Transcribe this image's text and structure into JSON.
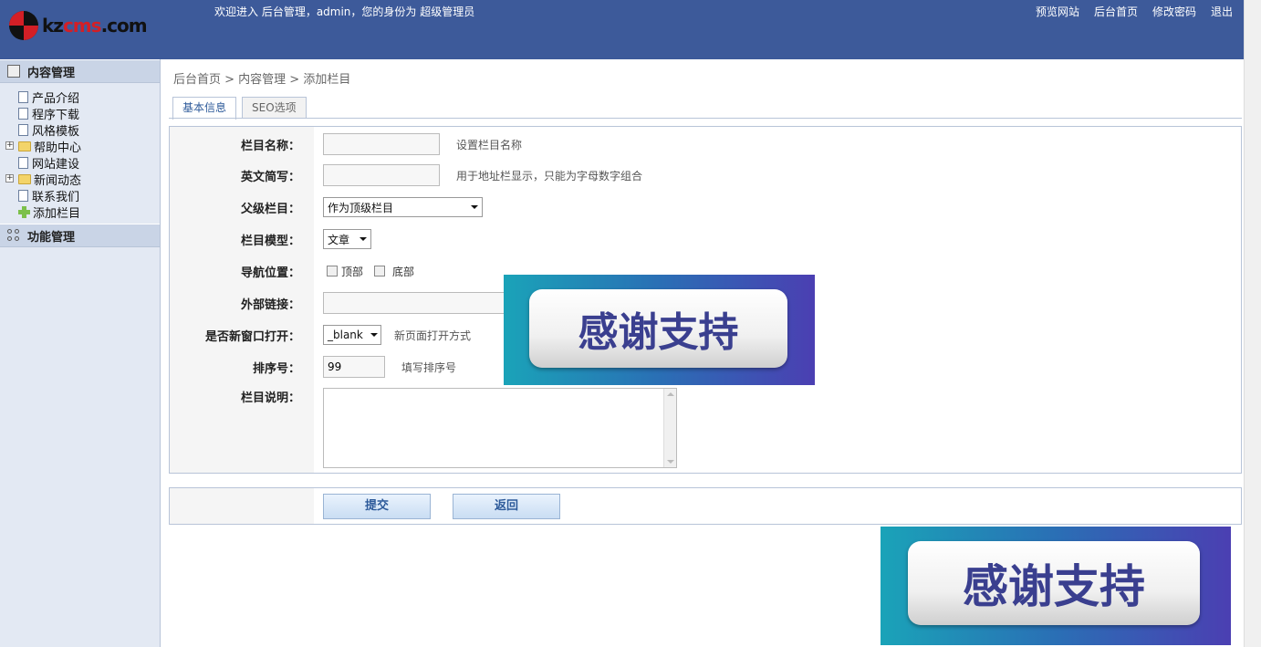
{
  "header": {
    "logo": {
      "text_main": "kz",
      "text_accent": "cms",
      "text_tail": ".com"
    },
    "welcome": "欢迎进入  后台管理，admin，您的身份为  超级管理员",
    "links": [
      "预览网站",
      "后台首页",
      "修改密码",
      "退出"
    ]
  },
  "sidebar": {
    "section1": "内容管理",
    "items": [
      {
        "label": "产品介绍",
        "icon": "doc-icon"
      },
      {
        "label": "程序下载",
        "icon": "doc-icon"
      },
      {
        "label": "风格模板",
        "icon": "doc-icon"
      },
      {
        "label": "帮助中心",
        "icon": "folder-icon",
        "expandable": true
      },
      {
        "label": "网站建设",
        "icon": "doc-icon"
      },
      {
        "label": "新闻动态",
        "icon": "folder-icon",
        "expandable": true
      },
      {
        "label": "联系我们",
        "icon": "doc-icon"
      },
      {
        "label": "添加栏目",
        "icon": "plus-icon"
      }
    ],
    "section2": "功能管理"
  },
  "breadcrumb": "后台首页 > 内容管理 > 添加栏目",
  "tabs": [
    "基本信息",
    "SEO选项"
  ],
  "form": {
    "name_label": "栏目名称：",
    "name_hint": "设置栏目名称",
    "abbr_label": "英文简写：",
    "abbr_hint": "用于地址栏显示，只能为字母数字组合",
    "parent_label": "父级栏目：",
    "parent_value": "作为顶级栏目",
    "model_label": "栏目模型：",
    "model_value": "文章",
    "nav_label": "导航位置：",
    "nav_top": "顶部",
    "nav_bottom": "底部",
    "link_label": "外部链接：",
    "newwin_label": "是否新窗口打开：",
    "newwin_value": "_blank",
    "newwin_hint": "新页面打开方式",
    "order_label": "排序号：",
    "order_value": "99",
    "order_hint": "填写排序号",
    "desc_label": "栏目说明："
  },
  "buttons": {
    "submit": "提交",
    "back": "返回"
  },
  "banner": {
    "text": "感谢支持"
  }
}
